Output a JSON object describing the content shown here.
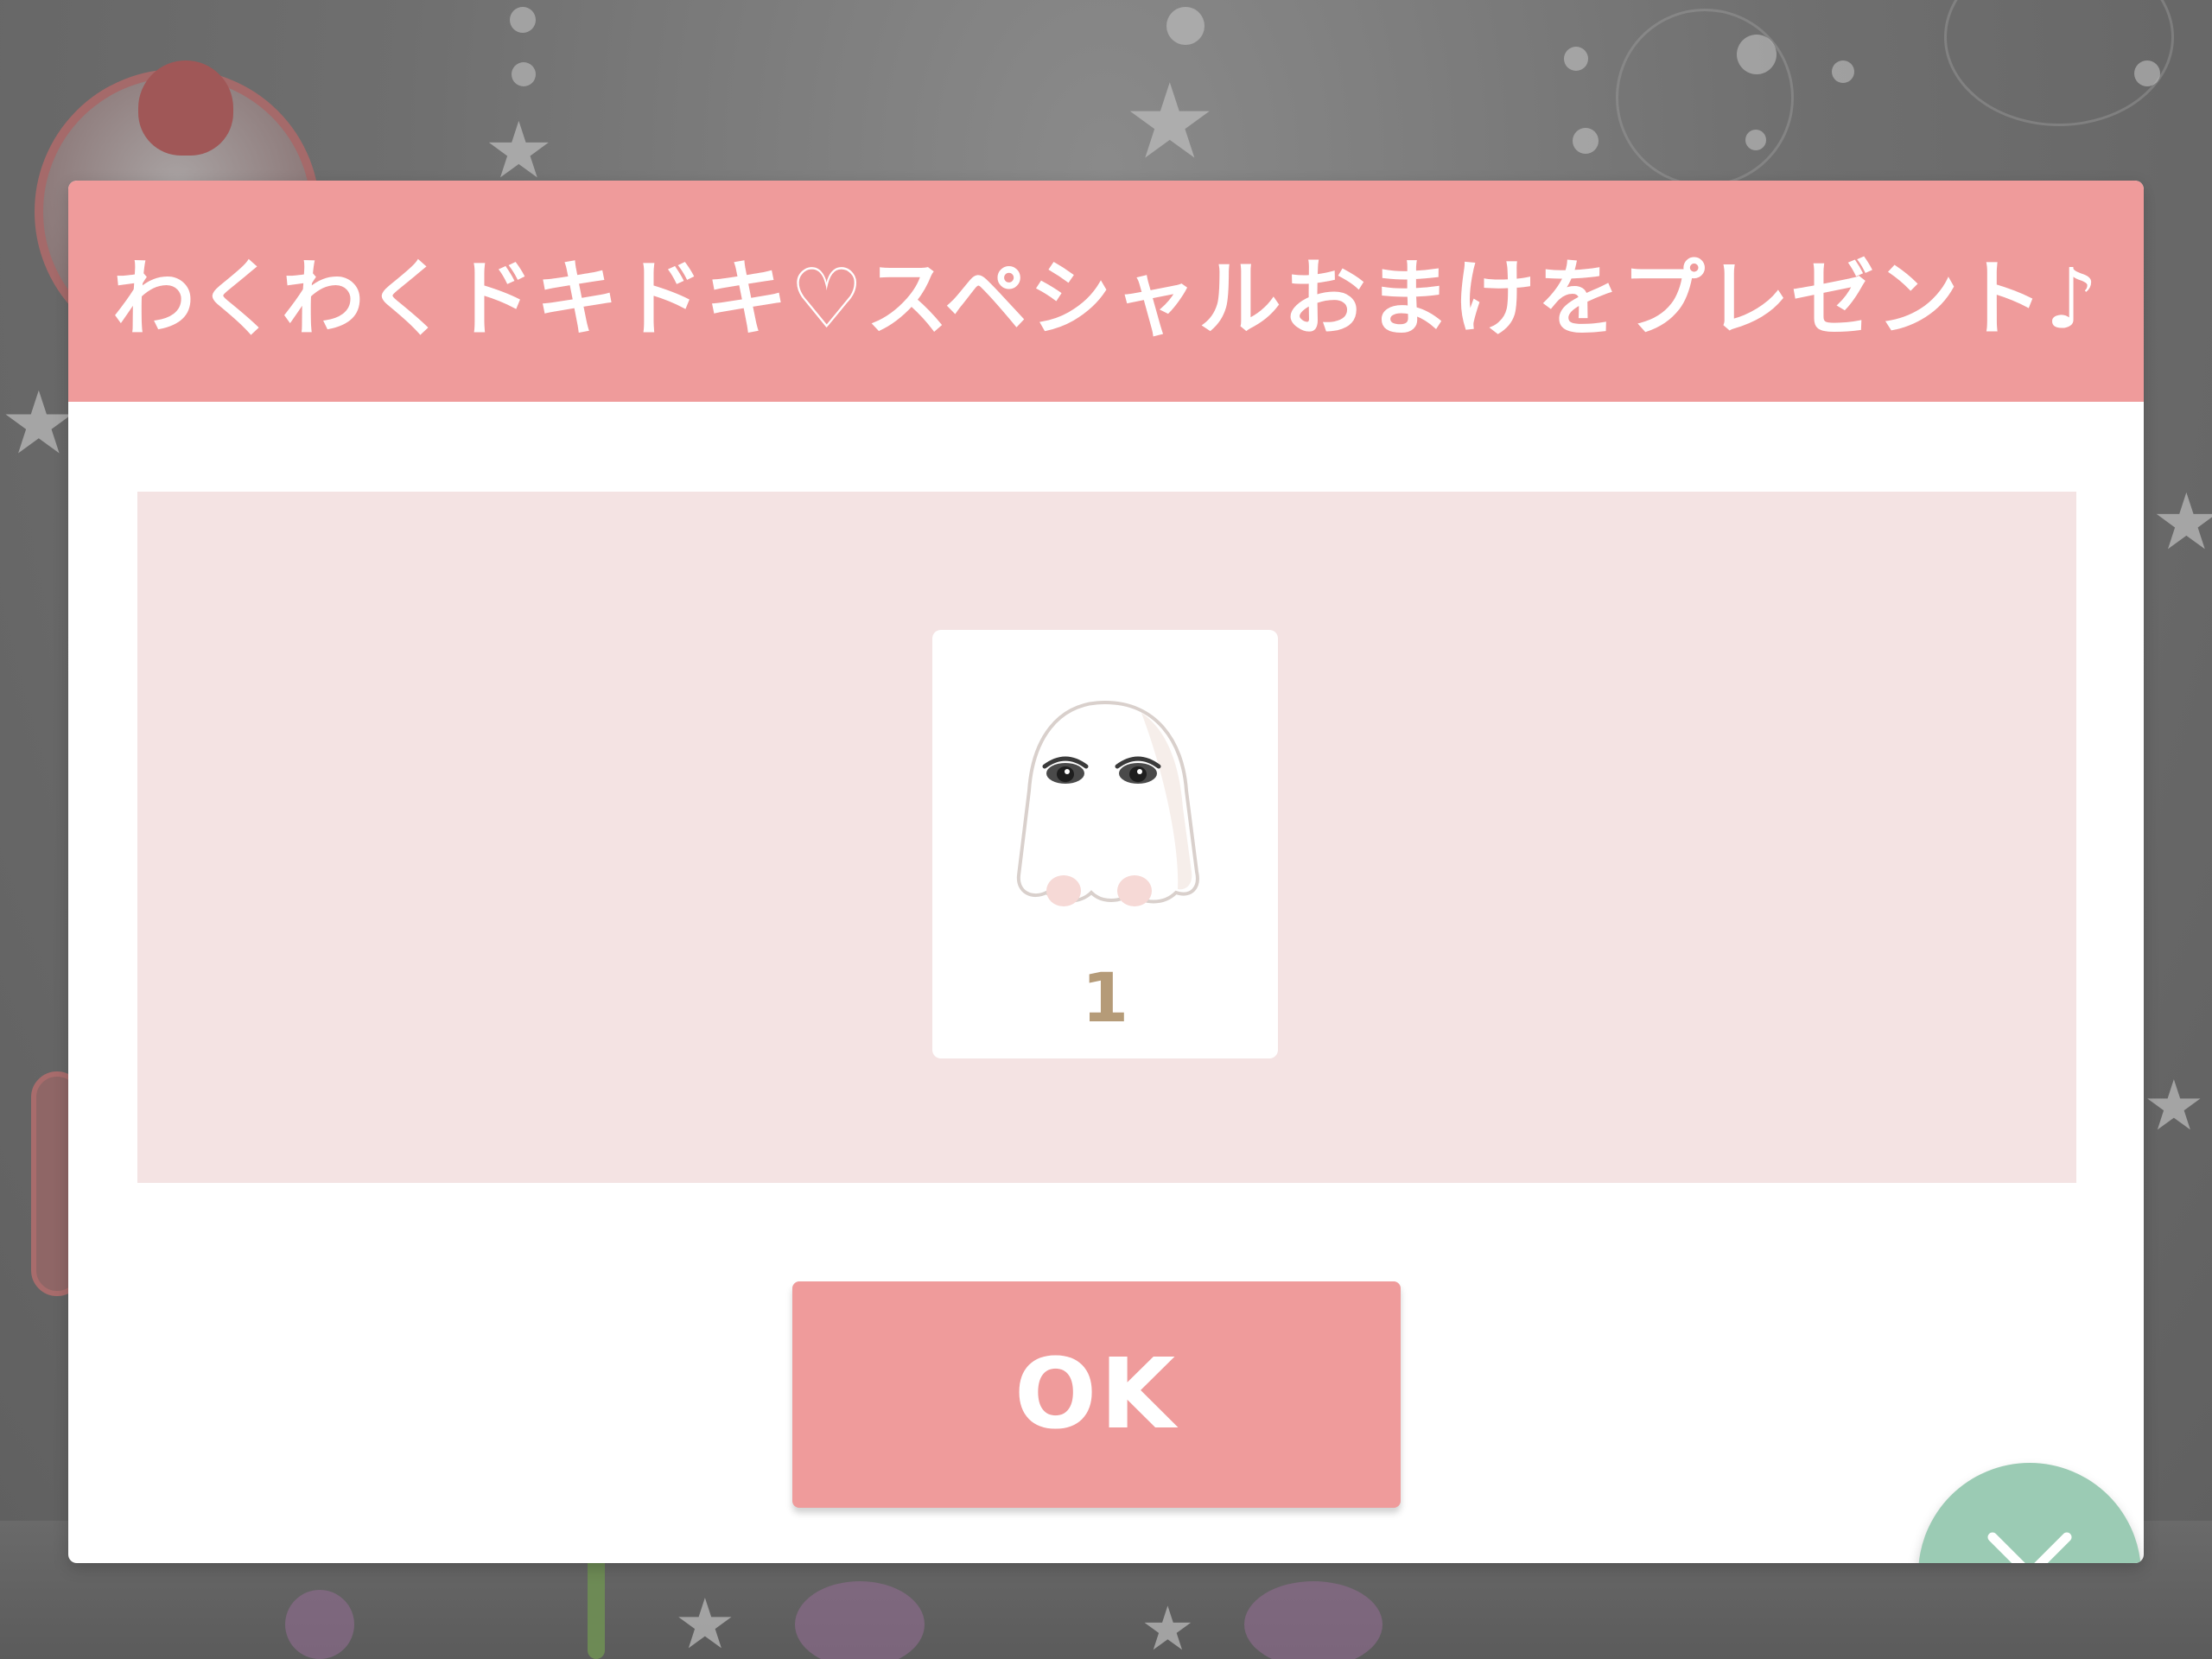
{
  "dialog": {
    "title": "わくわくドキドキ♡スペシャルおまけをプレゼント♪",
    "reward": {
      "icon": "ghost-icon",
      "count": "1"
    },
    "ok_label": "OK",
    "close_icon": "close-icon"
  },
  "colors": {
    "header": "#ef9b9b",
    "reward_area": "#f4e3e3",
    "ok_button": "#ef9b9b",
    "close_button": "#9bcbb4",
    "count_text": "#b59b78"
  }
}
